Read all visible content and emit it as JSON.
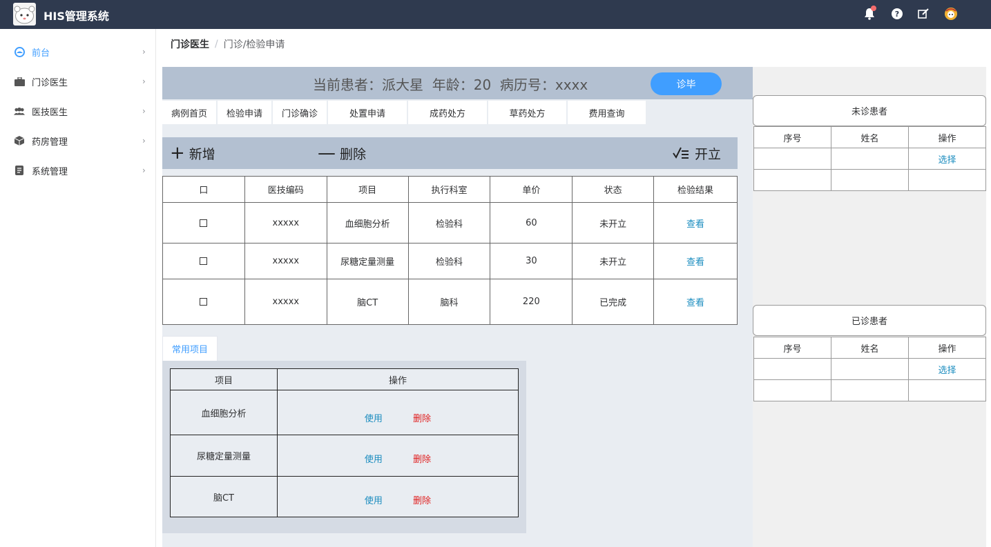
{
  "app": {
    "title": "HIS管理系统"
  },
  "header_icons": [
    "bell-icon",
    "help-icon",
    "edit-icon",
    "avatar"
  ],
  "sidebar": {
    "items": [
      {
        "label": "前台",
        "icon": "dashboard-icon",
        "active": true
      },
      {
        "label": "门诊医生",
        "icon": "briefcase-icon"
      },
      {
        "label": "医技医生",
        "icon": "users-icon"
      },
      {
        "label": "药房管理",
        "icon": "box-icon"
      },
      {
        "label": "系统管理",
        "icon": "document-icon"
      }
    ]
  },
  "breadcrumb": {
    "root": "门诊医生",
    "separator": "/",
    "current": "门诊/检验申请"
  },
  "patient": {
    "info": "当前患者：派大星  年龄：20  病历号：xxxx",
    "done_label": "诊毕"
  },
  "tabs": [
    "病例首页",
    "检验申请",
    "门诊确诊",
    "处置申请",
    "成药处方",
    "草药处方",
    "费用查询"
  ],
  "toolbar": {
    "add_label": "新增",
    "delete_label": "删除",
    "issue_label": "开立"
  },
  "exam_table": {
    "headers": [
      "口",
      "医技编码",
      "项目",
      "执行科室",
      "单价",
      "状态",
      "检验结果"
    ],
    "rows": [
      {
        "code": "xxxxx",
        "item": "血细胞分析",
        "dept": "检验科",
        "price": "60",
        "status": "未开立",
        "result": "查看"
      },
      {
        "code": "xxxxx",
        "item": "尿糖定量测量",
        "dept": "检验科",
        "price": "30",
        "status": "未开立",
        "result": "查看"
      },
      {
        "code": "xxxxx",
        "item": "脑CT",
        "dept": "脑科",
        "price": "220",
        "status": "已完成",
        "result": "查看"
      }
    ]
  },
  "common": {
    "tab_label": "常用项目",
    "headers": [
      "项目",
      "操作"
    ],
    "use_label": "使用",
    "delete_label": "删除",
    "rows": [
      {
        "item": "血细胞分析"
      },
      {
        "item": "尿糖定量测量"
      },
      {
        "item": "脑CT"
      }
    ]
  },
  "waiting_patients": {
    "title": "未诊患者",
    "headers": [
      "序号",
      "姓名",
      "操作"
    ],
    "select_label": "选择"
  },
  "done_patients": {
    "title": "已诊患者",
    "headers": [
      "序号",
      "姓名",
      "操作"
    ],
    "select_label": "选择"
  },
  "colors": {
    "topbar": "#2f3a4f",
    "accent": "#409eff",
    "link": "#1a8cbf",
    "danger": "#e02020",
    "bar": "#b3c0d1"
  }
}
